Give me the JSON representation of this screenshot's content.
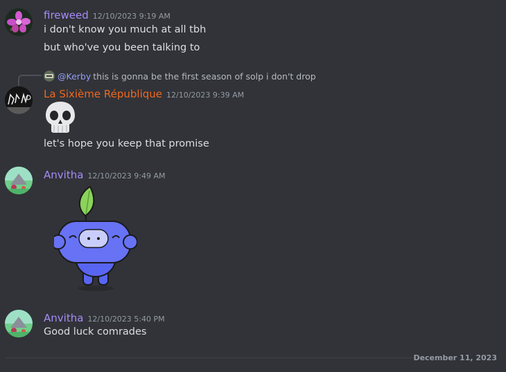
{
  "messages": [
    {
      "author": "fireweed",
      "author_color": "#a78bfa",
      "timestamp": "12/10/2023 9:19 AM",
      "lines": [
        "i don't know you much at all tbh",
        "but who've you been talking to"
      ]
    },
    {
      "reply": {
        "mention": "@Kerby",
        "text": "this is gonna be the first season of solp i don't drop"
      },
      "author": "La Sixième République",
      "author_color": "#f0671e",
      "timestamp": "12/10/2023 9:39 AM",
      "emoji": "skull-emoji",
      "lines": [
        "let's hope you keep that promise"
      ]
    },
    {
      "author": "Anvitha",
      "author_color": "#a78bfa",
      "timestamp": "12/10/2023 9:49 AM",
      "sticker": "wumpus-leaf-sticker"
    },
    {
      "author": "Anvitha",
      "author_color": "#a78bfa",
      "timestamp": "12/10/2023 5:40 PM",
      "lines": [
        "Good luck comrades"
      ]
    }
  ],
  "date_divider": "December 11, 2023"
}
